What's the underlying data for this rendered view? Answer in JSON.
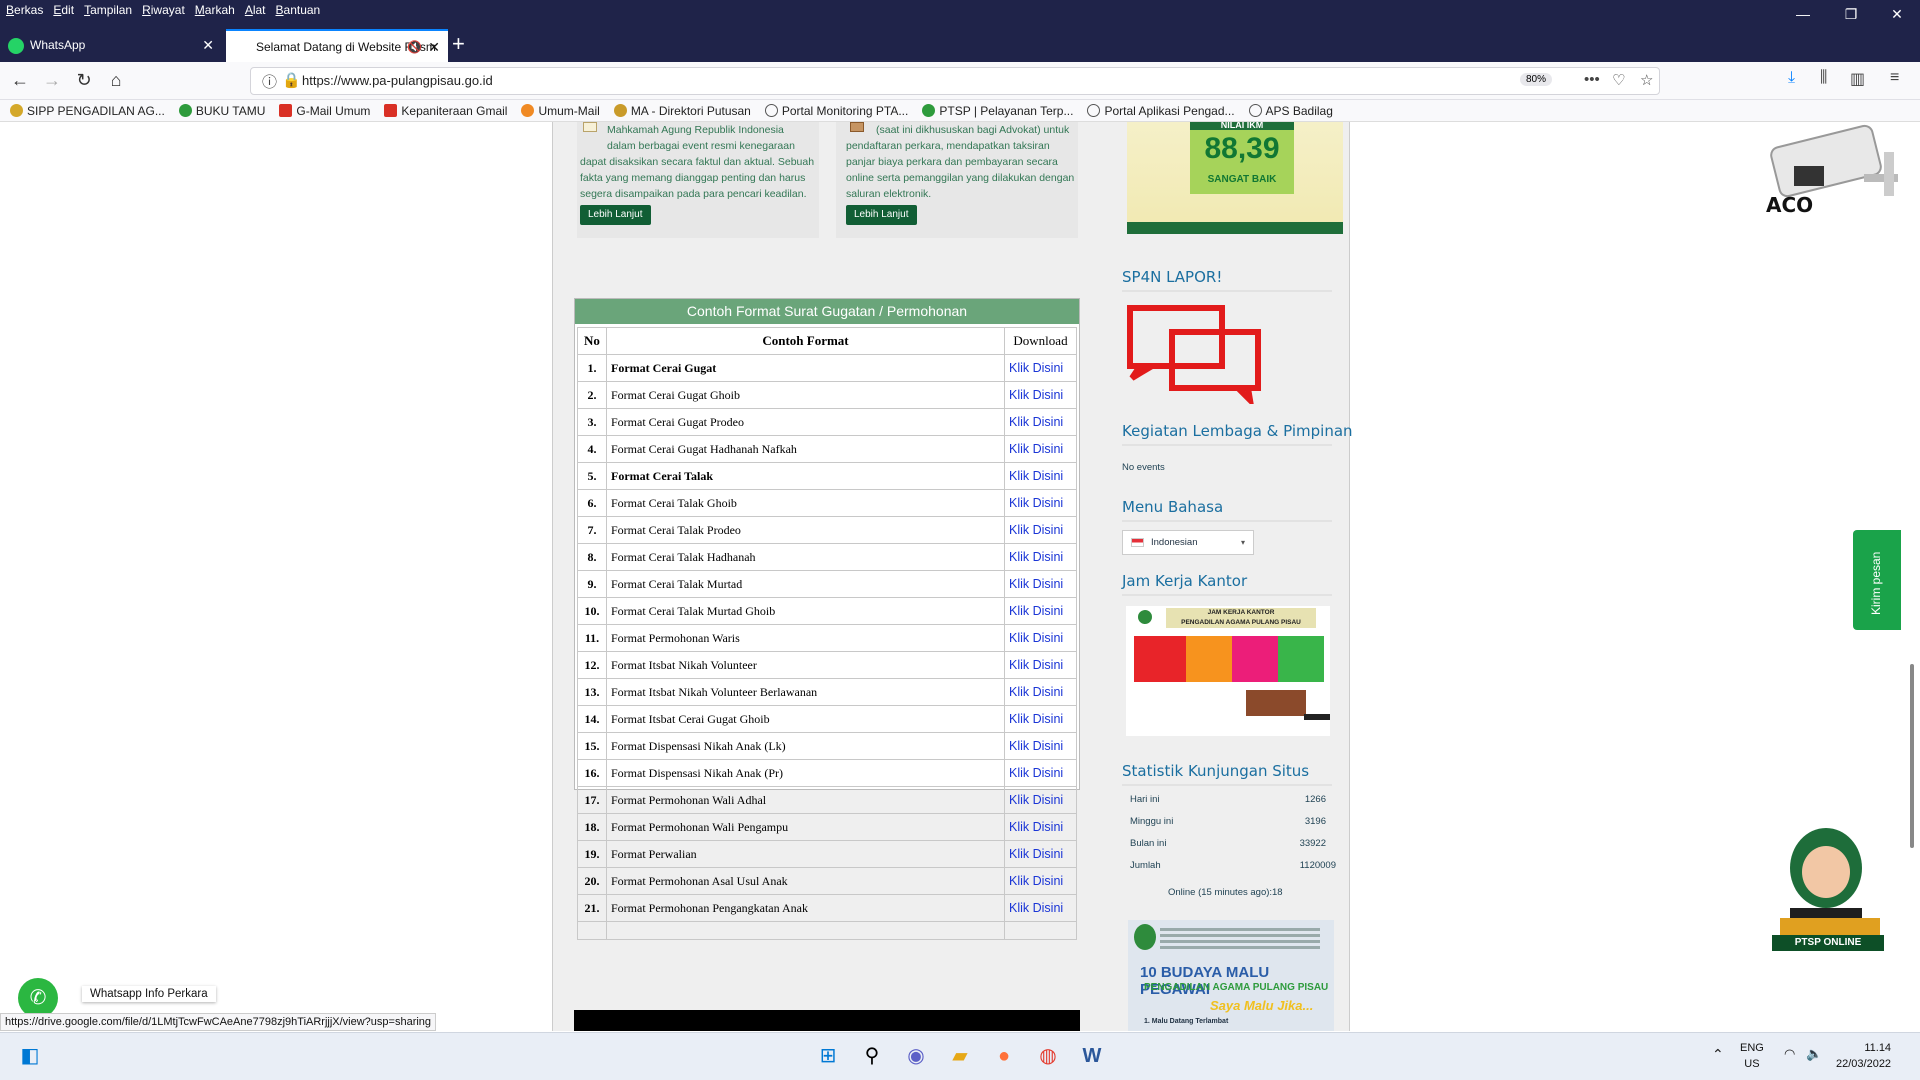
{
  "browser": {
    "menu": [
      "Berkas",
      "Edit",
      "Tampilan",
      "Riwayat",
      "Markah",
      "Alat",
      "Bantuan"
    ],
    "tabs": [
      {
        "label": "WhatsApp"
      },
      {
        "label": "Selamat Datang di Website Resm"
      }
    ],
    "url": "https://www.pa-pulangpisau.go.id",
    "zoom": "80%",
    "bookmarks": [
      {
        "label": "SIPP PENGADILAN AG...",
        "color": "#d4a82a"
      },
      {
        "label": "BUKU TAMU",
        "color": "#2e9b3c"
      },
      {
        "label": "G-Mail Umum",
        "color": "#d93025"
      },
      {
        "label": "Kepaniteraan Gmail",
        "color": "#d93025"
      },
      {
        "label": "Umum-Mail",
        "color": "#f08a24"
      },
      {
        "label": "MA - Direktori Putusan",
        "color": "#c99b2a"
      },
      {
        "label": "Portal Monitoring PTA...",
        "color": "#555555"
      },
      {
        "label": "PTSP | Pelayanan Terp...",
        "color": "#2e9b3c"
      },
      {
        "label": "Portal Aplikasi Pengad...",
        "color": "#555555"
      },
      {
        "label": "APS Badilag",
        "color": "#555555"
      }
    ]
  },
  "cards": {
    "left_text": [
      "Mahkamah Agung Republik Indonesia",
      "dalam berbagai event resmi kenegaraan",
      "dapat disaksikan secara faktul dan aktual. Sebuah",
      "fakta yang memang dianggap penting dan harus",
      "segera disampaikan pada para pencari keadilan."
    ],
    "right_text": [
      "(saat ini dikhususkan bagi Advokat) untuk",
      "pendaftaran perkara, mendapatkan taksiran",
      "panjar biaya perkara dan pembayaran secara",
      "online serta pemanggilan yang dilakukan dengan",
      "saluran elektronik."
    ],
    "button_label": "Lebih Lanjut"
  },
  "table": {
    "title": "Contoh Format Surat Gugatan / Permohonan",
    "headers": {
      "no": "No",
      "name": "Contoh Format",
      "download": "Download"
    },
    "rows": [
      {
        "no": "1.",
        "name": "Format Cerai Gugat",
        "link": "Klik Disini",
        "bold": true
      },
      {
        "no": "2.",
        "name": "Format Cerai Gugat Ghoib",
        "link": "Klik Disini",
        "bold": false
      },
      {
        "no": "3.",
        "name": "Format Cerai Gugat Prodeo",
        "link": "Klik Disini",
        "bold": false
      },
      {
        "no": "4.",
        "name": "Format Cerai Gugat Hadhanah Nafkah",
        "link": "Klik Disini",
        "bold": false
      },
      {
        "no": "5.",
        "name": "Format Cerai Talak",
        "link": "Klik Disini",
        "bold": true
      },
      {
        "no": "6.",
        "name": "Format Cerai Talak Ghoib",
        "link": "Klik Disini",
        "bold": false
      },
      {
        "no": "7.",
        "name": "Format Cerai Talak Prodeo",
        "link": "Klik Disini",
        "bold": false
      },
      {
        "no": "8.",
        "name": "Format Cerai Talak Hadhanah",
        "link": "Klik Disini",
        "bold": false
      },
      {
        "no": "9.",
        "name": "Format Cerai Talak Murtad",
        "link": "Klik Disini",
        "bold": false
      },
      {
        "no": "10.",
        "name": "Format Cerai Talak Murtad Ghoib",
        "link": "Klik Disini",
        "bold": false
      },
      {
        "no": "11.",
        "name": "Format Permohonan Waris",
        "link": "Klik Disini",
        "bold": false
      },
      {
        "no": "12.",
        "name": "Format Itsbat Nikah Volunteer",
        "link": "Klik Disini",
        "bold": false
      },
      {
        "no": "13.",
        "name": "Format Itsbat Nikah Volunteer Berlawanan",
        "link": "Klik Disini",
        "bold": false
      },
      {
        "no": "14.",
        "name": "Format Itsbat Cerai Gugat Ghoib",
        "link": "Klik Disini",
        "bold": false
      },
      {
        "no": "15.",
        "name": "Format Dispensasi Nikah Anak (Lk)",
        "link": "Klik Disini",
        "bold": false
      },
      {
        "no": "16.",
        "name": "Format Dispensasi Nikah Anak (Pr)",
        "link": "Klik Disini",
        "bold": false
      },
      {
        "no": "17.",
        "name": "Format Permohonan Wali Adhal",
        "link": "Klik Disini",
        "bold": false
      },
      {
        "no": "18.",
        "name": "Format Permohonan Wali Pengampu",
        "link": "Klik Disini",
        "bold": false
      },
      {
        "no": "19.",
        "name": "Format Perwalian",
        "link": "Klik Disini",
        "bold": false
      },
      {
        "no": "20.",
        "name": "Format Permohonan Asal Usul Anak",
        "link": "Klik Disini",
        "bold": false
      },
      {
        "no": "21.",
        "name": "Format Permohonan Pengangkatan Anak",
        "link": "Klik Disini",
        "bold": false
      }
    ]
  },
  "sidebar": {
    "ikm": {
      "heading": "NILAI IKM",
      "value": "88,39",
      "label": "SANGAT BAIK"
    },
    "sp4n": "SP4N LAPOR!",
    "kegiatan": "Kegiatan Lembaga & Pimpinan",
    "no_events": "No events",
    "menu_bahasa": "Menu Bahasa",
    "language": "Indonesian",
    "jam_kerja": "Jam Kerja Kantor",
    "jam_banner_title": "JAM KERJA KANTOR",
    "jam_banner_sub": "PENGADILAN AGAMA PULANG PISAU",
    "statistik": "Statistik Kunjungan Situs",
    "stats": [
      {
        "label": "Hari ini",
        "value": "1266"
      },
      {
        "label": "Minggu ini",
        "value": "3196"
      },
      {
        "label": "Bulan ini",
        "value": "33922"
      },
      {
        "label": "Jumlah",
        "value": "1120009"
      }
    ],
    "online": "Online (15 minutes ago):18",
    "budaya_title": "10 BUDAYA MALU PEGAWAI",
    "budaya_sub": "PENGADILAN AGAMA PULANG PISAU",
    "budaya_tag": "Saya Malu Jika...",
    "budaya_item": "1.   Malu Datang Terlambat"
  },
  "widgets": {
    "kirim_pesan": "Kirim pesan",
    "wa_label": "Whatsapp Info Perkara",
    "ptsp": "PTSP ONLINE",
    "aco": "ACO",
    "status_url": "https://drive.google.com/file/d/1LMtjTcwFwCAeAne7798zj9hTiARrjjjX/view?usp=sharing"
  },
  "taskbar": {
    "lang1": "ENG",
    "lang2": "US",
    "time": "11.14",
    "date": "22/03/2022"
  }
}
